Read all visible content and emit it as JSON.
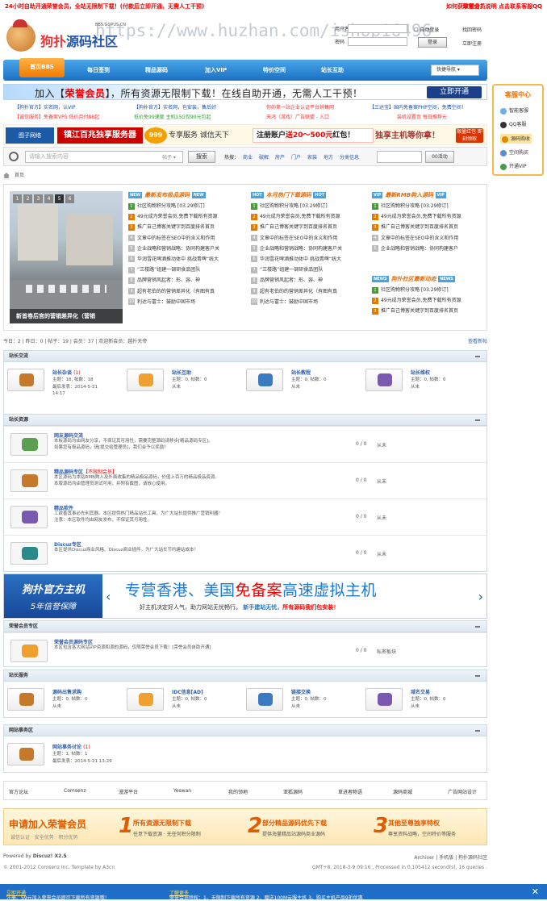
{
  "topbar": {
    "left": "24小时自助开通荣誉会员，全站无限制下载！(付款后立即开通，无需人工干预)",
    "right": "如何获取积分？",
    "right2": "荣誉会员说明  点击联系客服QQ"
  },
  "header": {
    "logo_main": "狗扑",
    "logo_rest": "源码社区",
    "logo_small": "BBS.GOPUS.CN",
    "watermark": "https://www.huzhan.com/ishop16496"
  },
  "login": {
    "user_label": "用户名",
    "pass_label": "密码",
    "auto": "自动登录",
    "login_btn": "登录",
    "forgot": "找回密码",
    "register": "立即注册"
  },
  "nav": {
    "home": "首页BBS",
    "items": [
      "每日签到",
      "精品源码",
      "加入VIP",
      "特价空间",
      "站长互助"
    ],
    "quick": "快捷导航"
  },
  "side": {
    "title": "客服中心",
    "items": [
      "智能客服",
      "QQ客服",
      "源码购收",
      "空间购买",
      "开通VIP"
    ]
  },
  "vip_banner": {
    "text_a": "加入【",
    "text_b": "荣誉会员",
    "text_c": "】，所有资源无限制下载！在线自助开通，无需人工干预！",
    "button": "立即开通"
  },
  "link_rows": [
    [
      "【狗扑官方】实名网，认VIP",
      "【狗扑官方】实名网，包安装，售后好",
      "你的第一站企业认证平台销售网",
      "【三达宝】国内免备案PHP空间，免费空间！"
    ],
    [
      "【诚信服务】免备案VPS 低价月付88起",
      "低价免99速度 主机15G仅90元包起",
      "天鸿（游戏）广告联盟 - 入口",
      "装机设置页  每日推荐元"
    ]
  ],
  "ad2": {
    "a1": "图子网络",
    "a2": "镇江百兆独享服务器",
    "a3": "999",
    "a4": "专享服务 诚信天下",
    "a5_a": "注册账户",
    "a5_b": "送20～500元",
    "a5_c": "红包！",
    "a6": "独享主机等你拿！",
    "a7": "限量红包 即刻领取"
  },
  "search": {
    "placeholder": "请输入搜索内容",
    "scope": "帖子",
    "button": "搜索",
    "hot_label": "热搜：",
    "hot": [
      "商业",
      "破解",
      "房产",
      "门户",
      "家装",
      "地方",
      "分类信息"
    ],
    "button2": "00活动"
  },
  "breadcrumb": {
    "home": "首页"
  },
  "portal": {
    "pages": [
      "1",
      "2",
      "3",
      "4",
      "5",
      "6"
    ],
    "caption": "新首卷后宫的营销差异化（营销",
    "col1": {
      "tag": "NEW",
      "title": "最新发布极品源码",
      "tag2": "NEW"
    },
    "col2": {
      "tag": "HOT",
      "title": "本月热门下载源码",
      "tag2": "HOT"
    },
    "col3": {
      "tag": "VIP",
      "title": "最新RMB购入源码",
      "tag2": "VIP"
    },
    "col4": {
      "tag": "NEWS",
      "title": "狗扑社区最新动态",
      "tag2": "NEWS"
    },
    "list": [
      "社区购物积分攻略  [03.29修订]",
      "49元成为荣誉会员,免费下载所有资源",
      "推广自己博客关键字到百度排名首页",
      "文章中的标签在SEO中的含义和作用",
      "企业战略和营销战略：协同构建客户关",
      "华润雪花啤酒推动体中 挑战青啤“统大",
      "“三楼路”组建一调研食品团队",
      "品牌营销风起者：形、容、神",
      "超有老伯的的营销差异化（有图有真",
      "利达与富士：鼓励中国市场"
    ],
    "list3": [
      "社区购物积分攻略  [03.29修订]",
      "49元成为荣誉会员,免费下载所有资源",
      "推广自己博客关键字到百度排名首页",
      "文章中的标签在SEO中的含义和作用",
      "企业战略和营销战略：协同构建客户"
    ],
    "list4": [
      "社区购物积分攻略  [03.29修订]",
      "49元成为荣誉会员,免费下载所有资源",
      "推广自己博客关键字到百度排名首页"
    ]
  },
  "stats": {
    "text": "今日：2 | 昨日：0 | 帖子：19 | 会员：37 | 欢迎新会员：越扑天帝",
    "right": "查看新帖"
  },
  "sec1": {
    "title": "站长交流",
    "cells": [
      {
        "name": "站长杂谈",
        "new": "(1)",
        "s1": "主题：18, 帖数：18",
        "s2": "最后发表：2014-5-21",
        "s3": "14:17"
      },
      {
        "name": "站长互助",
        "new": "",
        "s1": "主题：0, 帖数：0",
        "s2": "从未",
        "s3": ""
      },
      {
        "name": "站长教程",
        "new": "",
        "s1": "主题：0, 帖数：0",
        "s2": "从未",
        "s3": ""
      },
      {
        "name": "站长维权",
        "new": "",
        "s1": "主题：0, 帖数：0",
        "s2": "从未",
        "s3": ""
      }
    ]
  },
  "sec2": {
    "title": "站长资源",
    "rows": [
      {
        "name": "网友源码交流",
        "new": "",
        "d1": "本板源码均由网友分享，不保证其可用性，需要完整源码请移步[精品源码专区]。",
        "d2": "如果您有极品源码，请[提交给管理员]，我们会予以奖励！",
        "ct": "0 / 0",
        "lt": "从未"
      },
      {
        "name": "精品源码专区",
        "new": "【不限制会员】",
        "d1": "本区源码为本站RMB购入及外面收集的精品极品源码，价值上百万的精品极品资源。",
        "d2": "本版源码均由管理员测试可用，并附有截图，请放心使用。",
        "ct": "0 / 0",
        "lt": "从未"
      },
      {
        "name": "精品软件",
        "new": "",
        "d1": "工欲善其事必先利其器。本区提供热门精品站长工具，为广大站长提供推广营销利器！",
        "d2": "注意：本区软件均由网友发布，不保证其可用性。",
        "ct": "0 / 0",
        "lt": "从未"
      },
      {
        "name": "Discuz专区",
        "new": "",
        "d1": "本区提供Discuz商业风格、Discuz商业插件。为广大站长节约建站成本！",
        "d2": "",
        "ct": "0 / 0",
        "lt": "从未"
      }
    ]
  },
  "hostban": {
    "left_a": "狗扑官方主机",
    "left_b": "5年信誉保障",
    "main_a": "专营香港、美国",
    "main_b": "免备案",
    "main_c": "高速虚拟主机",
    "sub_a": "好主机决定好人气，助力网站无忧畅行。",
    "sub_b": "新手建站无忧，",
    "sub_c": "所有源码我们包安装！"
  },
  "sec3": {
    "title": "荣誉会员专区",
    "rows": [
      {
        "name": "荣誉会员源码专区",
        "new": "",
        "d1": "本区包含各大网站VIP资源和源的源码，仅限荣誉会员下载！[荣誉会员自助开通]",
        "d2": "",
        "ct": "0 / 0",
        "lt": "私密板块"
      }
    ]
  },
  "sec4": {
    "title": "站长服务",
    "cells": [
      {
        "name": "源码出售求购",
        "new": "",
        "s1": "主题：0, 帖数：0",
        "s2": "从未",
        "s3": ""
      },
      {
        "name": "IDC信息[AD]",
        "new": "",
        "s1": "主题：0, 帖数：0",
        "s2": "从未",
        "s3": ""
      },
      {
        "name": "链接交换",
        "new": "",
        "s1": "主题：0, 帖数：0",
        "s2": "从未",
        "s3": ""
      },
      {
        "name": "域名交易",
        "new": "",
        "s1": "主题：0, 帖数：0",
        "s2": "从未",
        "s3": ""
      }
    ]
  },
  "sec5": {
    "title": "网站事务区",
    "cells": [
      {
        "name": "网站事务讨论",
        "new": "(1)",
        "s1": "主题：1, 帖数：1",
        "s2": "最后发表：2014-5-21 13:29",
        "s3": ""
      }
    ]
  },
  "flinks": [
    "官方论坛",
    "Comsenz",
    "漫游平台",
    "Yeswan",
    "我的领地",
    "亚狐源码",
    "草进者物语",
    "源码商城",
    "广告网站设计"
  ],
  "joinban": {
    "t1": "申请加入荣誉会员",
    "t2": "诚信认证 · 安全优势 · 积分优势",
    "n1": "1",
    "h1": "所有资源无限制下载",
    "s1": "任意下载资源 · 无任何积分限制",
    "n2": "2",
    "h2": "部分精品源码优先下载",
    "s2": "提供海量精品站源码商业源码",
    "n3": "3",
    "h3": "其他至尊独享特权",
    "s3": "尊享资料战略，空间特价等服务"
  },
  "footer": {
    "powered": "Powered by",
    "discuz": "Discuz! X2.5",
    "links": "Archiver | 手机版 | 狗扑源码社区",
    "copy": "© 2001-2012 Comsenz Inc.  Template by A3cn",
    "time": "GMT+8, 2018-3-9 09:16 , Processed in 0.105412 second(s), 16 queries ."
  },
  "bottombar": {
    "a": "注册、59元加入荣誉会员即可下载所有资源哦！",
    "a_link": "立即开通",
    "b": "荣誉会员特权：1、无限制下载所有资源 2、赠送100M云服主机 3、购买主机产品9折优惠",
    "b_link": "了解更多",
    "close": "✕"
  }
}
